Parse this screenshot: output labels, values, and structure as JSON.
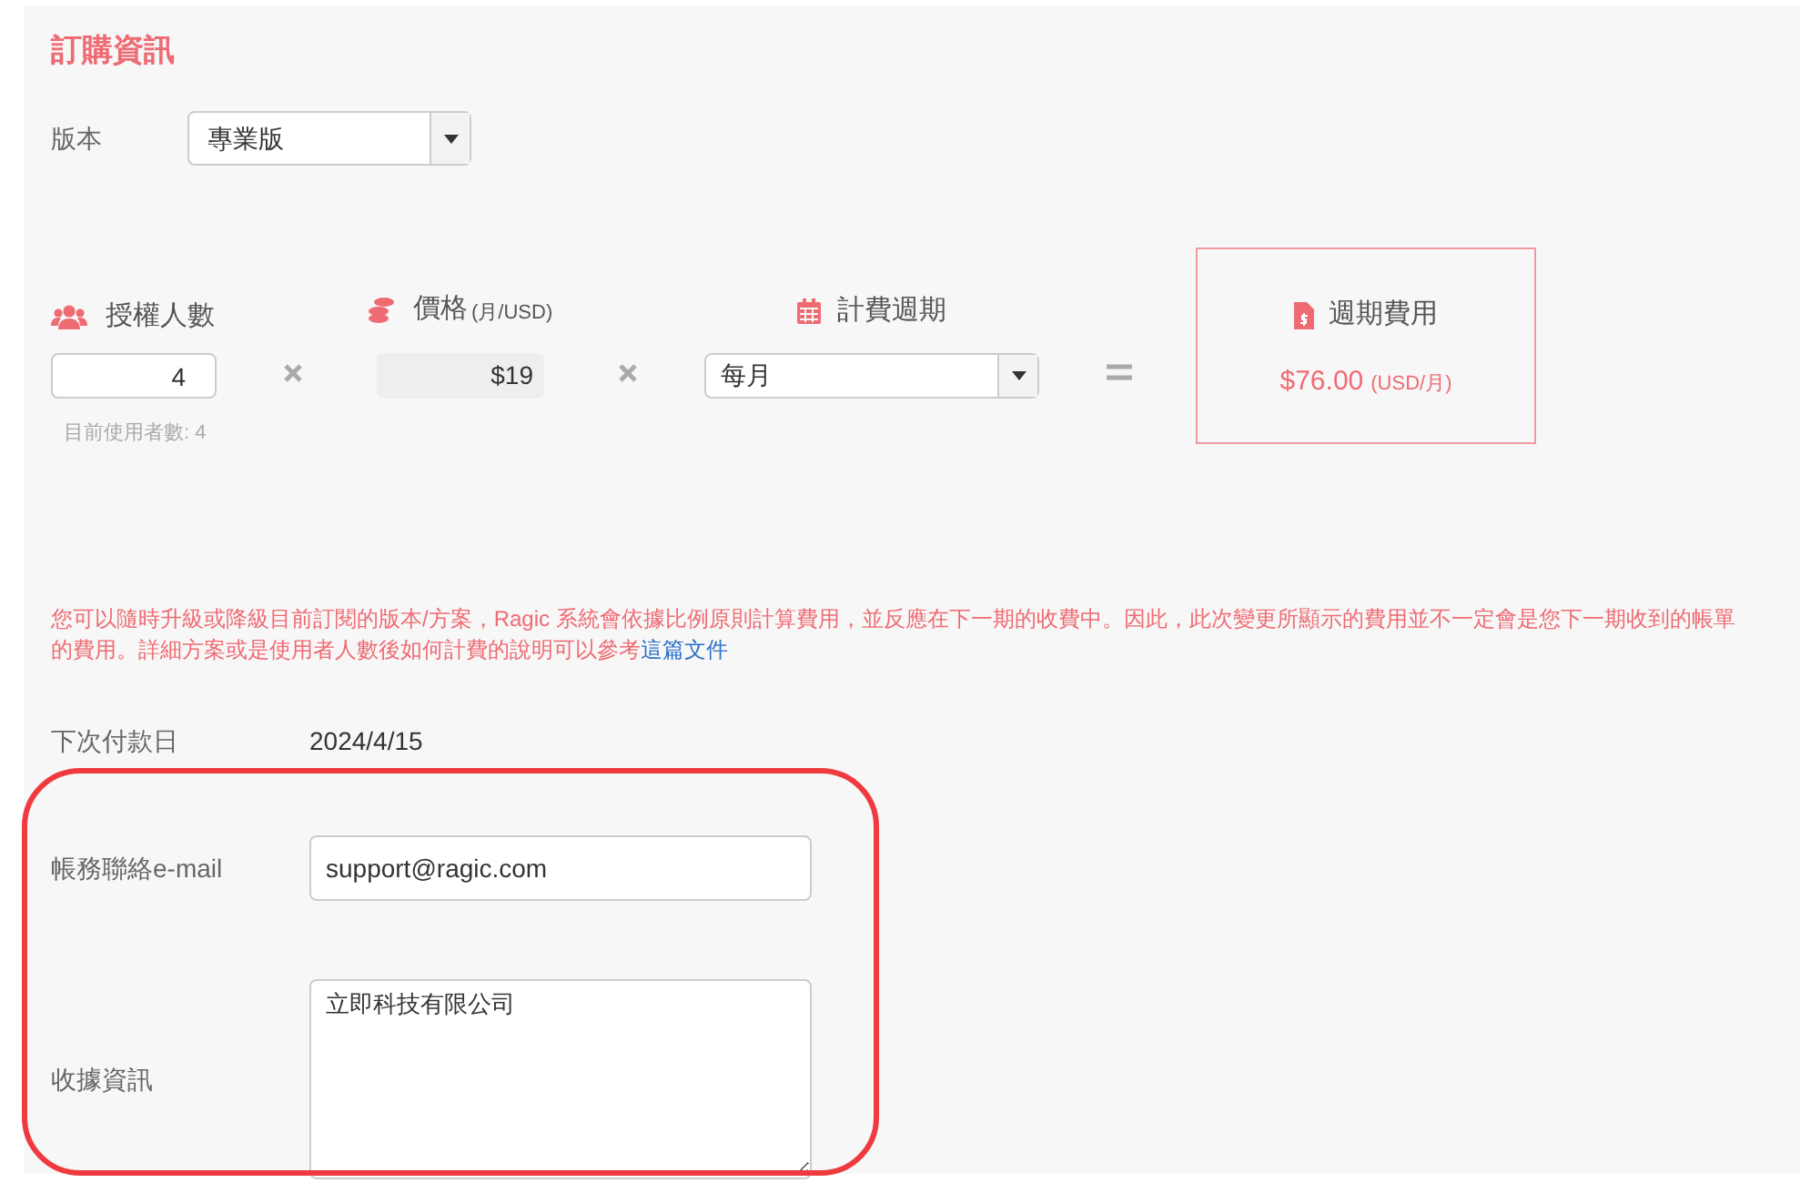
{
  "section_title": "訂購資訊",
  "plan": {
    "label": "版本",
    "value": "專業版"
  },
  "seats": {
    "label": "授權人數",
    "value": "4",
    "note": "目前使用者數: 4"
  },
  "price": {
    "label": "價格",
    "unit": "(月/USD)",
    "value": "$19"
  },
  "cycle": {
    "label": "計費週期",
    "value": "每月"
  },
  "total": {
    "label": "週期費用",
    "value": "$76.00",
    "unit": "(USD/月)"
  },
  "notice": {
    "text": "您可以隨時升級或降級目前訂閱的版本/方案，Ragic 系統會依據比例原則計算費用，並反應在下一期的收費中。因此，此次變更所顯示的費用並不一定會是您下一期收到的帳單的費用。詳細方案或是使用者人數後如何計費的說明可以參考",
    "link": "這篇文件"
  },
  "next_payment": {
    "label": "下次付款日",
    "value": "2024/4/15"
  },
  "billing_email": {
    "label": "帳務聯絡e-mail",
    "value": "support@ragic.com"
  },
  "receipt_info": {
    "label": "收據資訊",
    "value": "立即科技有限公司"
  }
}
